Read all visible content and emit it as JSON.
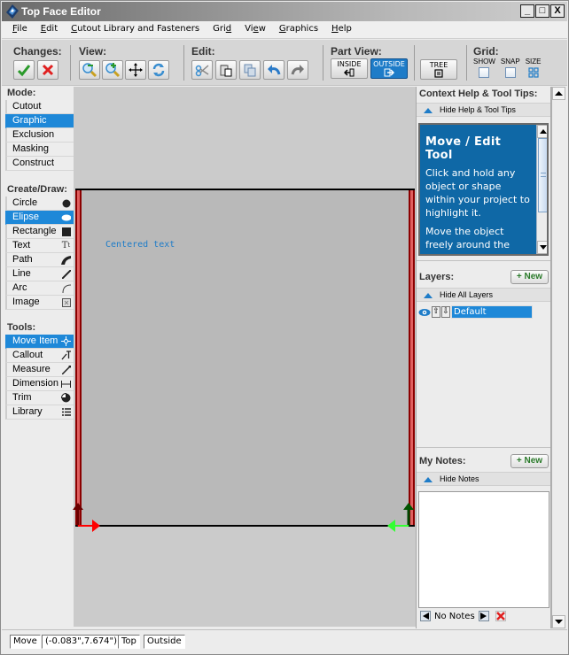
{
  "window": {
    "title": "Top Face Editor",
    "controls": {
      "minimize": "_",
      "maximize": "□",
      "close": "X"
    }
  },
  "menu": {
    "items": [
      {
        "label": "File",
        "mnemonic": "F"
      },
      {
        "label": "Edit",
        "mnemonic": "E"
      },
      {
        "label": "Cutout Library and Fasteners",
        "mnemonic": "C"
      },
      {
        "label": "Grid",
        "mnemonic": "d"
      },
      {
        "label": "View",
        "mnemonic": "e"
      },
      {
        "label": "Graphics",
        "mnemonic": "G"
      },
      {
        "label": "Help",
        "mnemonic": "H"
      }
    ]
  },
  "toolbar": {
    "changes": {
      "label": "Changes:",
      "buttons": [
        {
          "icon": "check-icon",
          "color": "#2a9a2a"
        },
        {
          "icon": "x-icon",
          "color": "#e02020"
        }
      ]
    },
    "view": {
      "label": "View:",
      "buttons": [
        {
          "icon": "zoom-out-icon"
        },
        {
          "icon": "zoom-in-icon"
        },
        {
          "icon": "pan-icon"
        },
        {
          "icon": "refresh-icon"
        }
      ]
    },
    "edit": {
      "label": "Edit:",
      "buttons": [
        {
          "icon": "cut-icon"
        },
        {
          "icon": "paste-icon"
        },
        {
          "icon": "copy-icon"
        },
        {
          "icon": "undo-icon"
        },
        {
          "icon": "redo-icon"
        }
      ]
    },
    "part_view": {
      "label": "Part View:",
      "inside": "INSIDE",
      "outside": "OUTSIDE",
      "active": "OUTSIDE",
      "tree": "TREE"
    },
    "grid": {
      "label": "Grid:",
      "show": "SHOW",
      "snap": "SNAP",
      "size": "SIZE"
    }
  },
  "left_panel": {
    "mode": {
      "label": "Mode:",
      "items": [
        "Cutout",
        "Graphic",
        "Exclusion",
        "Masking",
        "Construct"
      ],
      "selected": "Graphic"
    },
    "create_draw": {
      "label": "Create/Draw:",
      "items": [
        {
          "label": "Circle",
          "icon": "circle-icon"
        },
        {
          "label": "Elipse",
          "icon": "ellipse-icon"
        },
        {
          "label": "Rectangle",
          "icon": "rectangle-icon"
        },
        {
          "label": "Text",
          "icon": "text-icon"
        },
        {
          "label": "Path",
          "icon": "path-icon"
        },
        {
          "label": "Line",
          "icon": "line-icon"
        },
        {
          "label": "Arc",
          "icon": "arc-icon"
        },
        {
          "label": "Image",
          "icon": "image-icon"
        }
      ],
      "selected": "Elipse"
    },
    "tools": {
      "label": "Tools:",
      "items": [
        {
          "label": "Move Item",
          "icon": "move-icon"
        },
        {
          "label": "Callout",
          "icon": "callout-icon"
        },
        {
          "label": "Measure",
          "icon": "measure-icon"
        },
        {
          "label": "Dimension",
          "icon": "dimension-icon"
        },
        {
          "label": "Trim",
          "icon": "trim-icon"
        },
        {
          "label": "Library",
          "icon": "library-icon"
        }
      ],
      "selected": "Move Item"
    }
  },
  "canvas": {
    "text_item": "Centered text",
    "colors": {
      "board": "#b9b9b9",
      "edge": "#e06060",
      "text": "#1e7cc8",
      "x_axis": "#ff0000",
      "y_axis_right": "#00cc00"
    }
  },
  "right_panel": {
    "help": {
      "label": "Context Help & Tool Tips:",
      "hide_label": "Hide Help & Tool Tips",
      "title": "Move / Edit Tool",
      "paragraphs": [
        "Click and hold any object or shape within your project to highlight it.",
        "Move the object freely around the canvas."
      ]
    },
    "layers": {
      "label": "Layers:",
      "new_label": "+ New",
      "hide_label": "Hide All Layers",
      "items": [
        {
          "name": "Default",
          "visible": true
        }
      ]
    },
    "notes": {
      "label": "My Notes:",
      "new_label": "+ New",
      "hide_label": "Hide Notes",
      "status": "No Notes"
    }
  },
  "status_bar": {
    "tool": "Move",
    "coordinates": "(-0.083\",7.674\")",
    "face": "Top",
    "view": "Outside"
  }
}
